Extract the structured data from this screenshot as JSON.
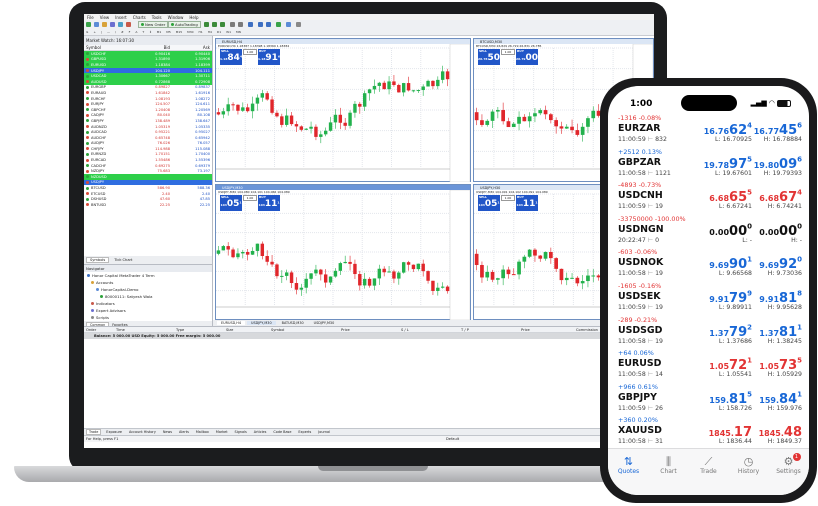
{
  "terminal": {
    "menu": [
      "File",
      "View",
      "Insert",
      "Charts",
      "Tools",
      "Window",
      "Help"
    ],
    "toolbar": {
      "new_order": "New Order",
      "autotrading": "AutoTrading"
    },
    "market_watch": {
      "title": "Market Watch: 16:07:30",
      "col_symbol": "Symbol",
      "col_bid": "Bid",
      "col_ask": "Ask",
      "rows": [
        {
          "symbol": "USDCHF",
          "bid": "0.90416",
          "ask": "0.90440",
          "bg": "#2ecf4a"
        },
        {
          "symbol": "GBPUSD",
          "bid": "1.31890",
          "ask": "1.31906",
          "bg": "#2ecf4a"
        },
        {
          "symbol": "EURUSD",
          "bid": "1.18384",
          "ask": "1.18399",
          "bg": "#2ecf4a"
        },
        {
          "symbol": "USDJPY",
          "bid": "104.120",
          "ask": "104.111",
          "bg": "#2f6de0"
        },
        {
          "symbol": "USDCAD",
          "bid": "1.30667",
          "ask": "1.30711",
          "bg": "#2ecf4a"
        },
        {
          "symbol": "AUDUSD",
          "bid": "0.72868",
          "ask": "0.72908",
          "bg": "#2ecf4a"
        },
        {
          "symbol": "EURGBP",
          "bid": "0.89827",
          "ask": "0.89837",
          "bg": ""
        },
        {
          "symbol": "EURAUD",
          "bid": "1.61842",
          "ask": "1.61916",
          "bg": ""
        },
        {
          "symbol": "EURCHF",
          "bid": "1.08193",
          "ask": "1.08272",
          "bg": ""
        },
        {
          "symbol": "EURJPY",
          "bid": "124.507",
          "ask": "124.611",
          "bg": ""
        },
        {
          "symbol": "GBPCHF",
          "bid": "1.20408",
          "ask": "1.20569",
          "bg": ""
        },
        {
          "symbol": "CADJPY",
          "bid": "80.040",
          "ask": "80.108",
          "bg": ""
        },
        {
          "symbol": "GBPJPY",
          "bid": "138.489",
          "ask": "138.647",
          "bg": ""
        },
        {
          "symbol": "AUDNZD",
          "bid": "1.05319",
          "ask": "1.05335",
          "bg": ""
        },
        {
          "symbol": "AUDCAD",
          "bid": "0.95221",
          "ask": "0.95027",
          "bg": ""
        },
        {
          "symbol": "AUDCHF",
          "bid": "0.65748",
          "ask": "0.65942",
          "bg": ""
        },
        {
          "symbol": "AUDJPY",
          "bid": "76.026",
          "ask": "76.057",
          "bg": ""
        },
        {
          "symbol": "CHFJPY",
          "bid": "114.988",
          "ask": "115.088",
          "bg": ""
        },
        {
          "symbol": "EURNZD",
          "bid": "1.70151",
          "ask": "1.70400",
          "bg": ""
        },
        {
          "symbol": "EURCAD",
          "bid": "1.55486",
          "ask": "1.55396",
          "bg": ""
        },
        {
          "symbol": "CADCHF",
          "bid": "0.69275",
          "ask": "0.69379",
          "bg": ""
        },
        {
          "symbol": "NZDJPY",
          "bid": "75.683",
          "ask": "73.197",
          "bg": ""
        },
        {
          "symbol": "NZDUSD",
          "bid": "",
          "ask": "",
          "bg": "#2ecf4a"
        },
        {
          "symbol": "USDJPY",
          "bid": "",
          "ask": "",
          "bg": "#2f6de0"
        },
        {
          "symbol": "BTCUSD",
          "bid": "586.90",
          "ask": "588.36",
          "bg": ""
        },
        {
          "symbol": "ETCUSD",
          "bid": "2.40",
          "ask": "2.40",
          "bg": ""
        },
        {
          "symbol": "DSHUSD",
          "bid": "47.60",
          "ask": "47.85",
          "bg": ""
        },
        {
          "symbol": "BNTUSD",
          "bid": "22.25",
          "ask": "22.25",
          "bg": ""
        }
      ],
      "tabs": [
        "Symbols",
        "Tick Chart"
      ]
    },
    "navigator": {
      "title": "Navigator",
      "items": [
        "Honor Capital MetaTrader 4 Term",
        "Accounts",
        "HonorCapital-Demo",
        "80000111: Satyesh Wala",
        "Indicators",
        "Expert Advisors",
        "Scripts"
      ],
      "tabs": [
        "Common",
        "Favorites"
      ]
    },
    "charts": [
      {
        "title": "EURUSD,H4",
        "info": "EURUSD,H4 1.18387 1.18398 1.18369 1.18384",
        "sell": "SELL",
        "buy": "BUY",
        "lot": "1.00",
        "sell_big": "84",
        "sell_small": "1.18",
        "sell_sup": "4",
        "buy_big": "91",
        "buy_small": "1.18",
        "buy_sup": "6"
      },
      {
        "title": "BTCUSD,M30",
        "info": "BTCUSD,M30 26.829 26.729 26.831 26.785",
        "sell": "SELL",
        "buy": "BUY",
        "lot": "1.00",
        "sell_big": "50",
        "sell_small": "26.78",
        "sell_sup": "",
        "buy_big": "00",
        "buy_small": "26.79",
        "buy_sup": ""
      },
      {
        "title": "USDJPY,M30",
        "info": "USDJPY,M30 104.080 104.101 104.066 104.089",
        "sell": "SELL",
        "buy": "BUY",
        "lot": "1.00",
        "sell_big": "05",
        "sell_small": "104",
        "sell_sup": "1",
        "buy_big": "11",
        "buy_small": "104",
        "buy_sup": "1"
      },
      {
        "title": "USDJPY,H30",
        "info": "USDJPY,M30 104.091 104.102 104.091 104.089",
        "sell": "SELL",
        "buy": "BUY",
        "lot": "1.00",
        "sell_big": "05",
        "sell_small": "104",
        "sell_sup": "1",
        "buy_big": "11",
        "buy_small": "104",
        "buy_sup": "1"
      }
    ],
    "chart_tabs": [
      "EURUSD,H4",
      "USDJPY,M30",
      "BATUSD,M30",
      "USDJPY,M30"
    ],
    "orders_header": [
      "Order",
      "Time",
      "Type",
      "Size",
      "Symbol",
      "Price",
      "S / L",
      "T / P",
      "Price",
      "Commission"
    ],
    "balance_line": "Balance: 5 000.00 USD  Equity: 5 000.00  Free margin: 5 000.00",
    "terminal_tabs": [
      "Trade",
      "Exposure",
      "Account History",
      "News",
      "Alerts",
      "Mailbox",
      "Market",
      "Signals",
      "Articles",
      "Code Base",
      "Experts",
      "Journal"
    ],
    "status_help": "For Help, press F1",
    "status_profile": "Default"
  },
  "phone": {
    "time": "1:00",
    "quotes": [
      {
        "chg": "-1316 -0.08%",
        "chg_color": "red",
        "symbol": "EURZAR",
        "time": "11:00:59",
        "spread": "832",
        "bid_pre": "16.76",
        "bid_big": "62",
        "bid_sup": "4",
        "bid_color": "blue",
        "ask_pre": "16.77",
        "ask_big": "45",
        "ask_sup": "6",
        "ask_color": "blue",
        "low": "L: 16.70925",
        "high": "H: 16.78884"
      },
      {
        "chg": "+2512 0.13%",
        "chg_color": "blue",
        "symbol": "GBPZAR",
        "time": "11:00:58",
        "spread": "1121",
        "bid_pre": "19.78",
        "bid_big": "97",
        "bid_sup": "5",
        "bid_color": "blue",
        "ask_pre": "19.80",
        "ask_big": "09",
        "ask_sup": "6",
        "ask_color": "blue",
        "low": "L: 19.67601",
        "high": "H: 19.79393"
      },
      {
        "chg": "-4893 -0.73%",
        "chg_color": "red",
        "symbol": "USDCNH",
        "time": "11:00:59",
        "spread": "19",
        "bid_pre": "6.68",
        "bid_big": "65",
        "bid_sup": "5",
        "bid_color": "red",
        "ask_pre": "6.68",
        "ask_big": "67",
        "ask_sup": "4",
        "ask_color": "red",
        "low": "L: 6.67241",
        "high": "H: 6.74241"
      },
      {
        "chg": "-33750000 -100.00%",
        "chg_color": "red",
        "symbol": "USDNGN",
        "time": "20:22:47",
        "spread": "0",
        "bid_pre": "0.00",
        "bid_big": "00",
        "bid_sup": "0",
        "bid_color": "black",
        "ask_pre": "0.00",
        "ask_big": "00",
        "ask_sup": "0",
        "ask_color": "black",
        "low": "L: -",
        "high": "H: -"
      },
      {
        "chg": "-603 -0.06%",
        "chg_color": "red",
        "symbol": "USDNOK",
        "time": "11:00:58",
        "spread": "19",
        "bid_pre": "9.69",
        "bid_big": "90",
        "bid_sup": "1",
        "bid_color": "blue",
        "ask_pre": "9.69",
        "ask_big": "92",
        "ask_sup": "0",
        "ask_color": "blue",
        "low": "L: 9.66568",
        "high": "H: 9.73036"
      },
      {
        "chg": "-1605 -0.16%",
        "chg_color": "red",
        "symbol": "USDSEK",
        "time": "11:00:59",
        "spread": "19",
        "bid_pre": "9.91",
        "bid_big": "79",
        "bid_sup": "9",
        "bid_color": "blue",
        "ask_pre": "9.91",
        "ask_big": "81",
        "ask_sup": "8",
        "ask_color": "blue",
        "low": "L: 9.89911",
        "high": "H: 9.95628"
      },
      {
        "chg": "-289 -0.21%",
        "chg_color": "red",
        "symbol": "USDSGD",
        "time": "11:00:58",
        "spread": "19",
        "bid_pre": "1.37",
        "bid_big": "79",
        "bid_sup": "2",
        "bid_color": "blue",
        "ask_pre": "1.37",
        "ask_big": "81",
        "ask_sup": "1",
        "ask_color": "blue",
        "low": "L: 1.37686",
        "high": "H: 1.38245"
      },
      {
        "chg": "+64 0.06%",
        "chg_color": "blue",
        "symbol": "EURUSD",
        "time": "11:00:58",
        "spread": "14",
        "bid_pre": "1.05",
        "bid_big": "72",
        "bid_sup": "1",
        "bid_color": "red",
        "ask_pre": "1.05",
        "ask_big": "73",
        "ask_sup": "5",
        "ask_color": "red",
        "low": "L: 1.05541",
        "high": "H: 1.05929"
      },
      {
        "chg": "+966 0.61%",
        "chg_color": "blue",
        "symbol": "GBPJPY",
        "time": "11:00:59",
        "spread": "26",
        "bid_pre": "159.",
        "bid_big": "81",
        "bid_sup": "5",
        "bid_color": "blue",
        "ask_pre": "159.",
        "ask_big": "84",
        "ask_sup": "1",
        "ask_color": "blue",
        "low": "L: 158.726",
        "high": "H: 159.976"
      },
      {
        "chg": "+360 0.20%",
        "chg_color": "blue",
        "symbol": "XAUUSD",
        "time": "11:00:58",
        "spread": "31",
        "bid_pre": "1845.",
        "bid_big": "17",
        "bid_sup": "",
        "bid_color": "red",
        "ask_pre": "1845.",
        "ask_big": "48",
        "ask_sup": "",
        "ask_color": "red",
        "low": "L: 1836.44",
        "high": "H: 1849.37"
      }
    ],
    "tabs": [
      {
        "label": "Quotes",
        "icon": "quotes-icon",
        "glyph": "⇅",
        "active": true
      },
      {
        "label": "Chart",
        "icon": "chart-icon",
        "glyph": "⫼",
        "active": false
      },
      {
        "label": "Trade",
        "icon": "trade-icon",
        "glyph": "⟋",
        "active": false
      },
      {
        "label": "History",
        "icon": "history-icon",
        "glyph": "◷",
        "active": false
      },
      {
        "label": "Settings",
        "icon": "settings-icon",
        "glyph": "⚙",
        "active": false
      }
    ],
    "settings_badge": "1"
  }
}
